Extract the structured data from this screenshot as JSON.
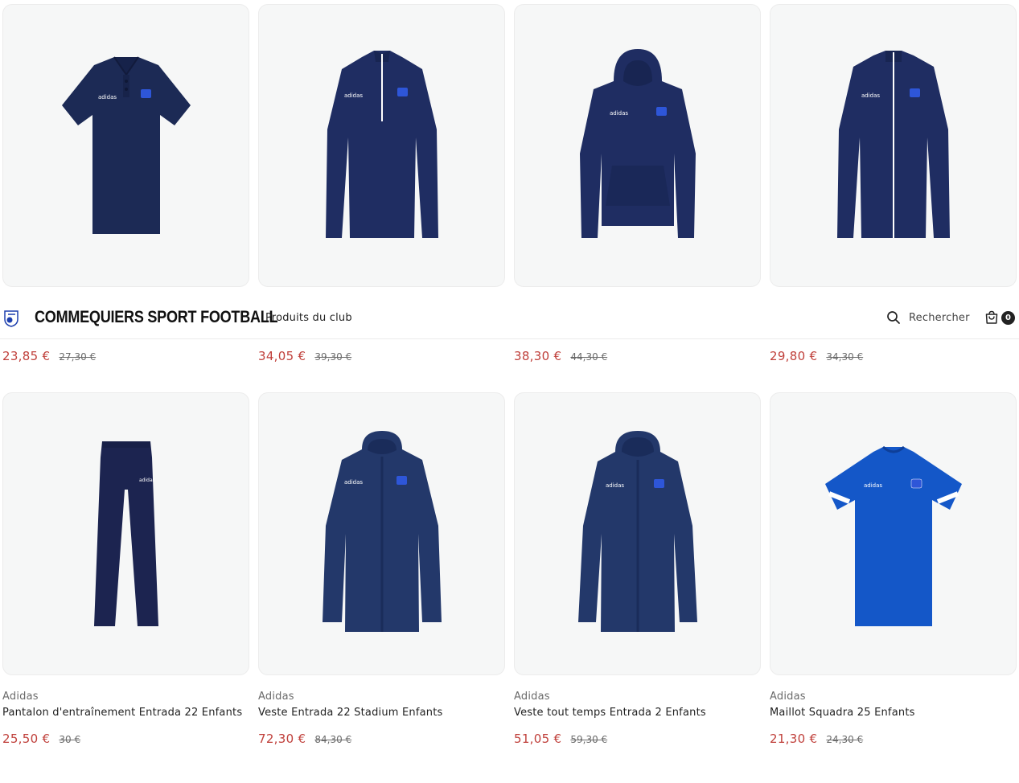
{
  "header": {
    "site_title": "COMMEQUIERS SPORT FOOTBALL",
    "nav": [
      {
        "label": "Produits du club"
      }
    ],
    "search_label": "Rechercher",
    "cart_count": "0"
  },
  "products": [
    {
      "brand": "",
      "name": "",
      "price": "23,85 €",
      "old_price": "27,30 €",
      "image": "polo-navy",
      "color": "#1c2a55"
    },
    {
      "brand": "",
      "name": "",
      "price": "34,05 €",
      "old_price": "39,30 €",
      "image": "quarter-zip-top-navy",
      "color": "#1f2d62"
    },
    {
      "brand": "",
      "name": "",
      "price": "38,30 €",
      "old_price": "44,30 €",
      "image": "hoodie-navy",
      "color": "#1f2d62"
    },
    {
      "brand": "",
      "name": "",
      "price": "29,80 €",
      "old_price": "34,30 €",
      "image": "track-jacket-navy",
      "color": "#1f2d62"
    },
    {
      "brand": "Adidas",
      "name": "Pantalon d'entraînement Entrada 22 Enfants",
      "price": "25,50 €",
      "old_price": "30 €",
      "image": "training-pants-navy",
      "color": "#1c2450"
    },
    {
      "brand": "Adidas",
      "name": "Veste Entrada 22 Stadium Enfants",
      "price": "72,30 €",
      "old_price": "84,30 €",
      "image": "stadium-jacket-navy",
      "color": "#23386a"
    },
    {
      "brand": "Adidas",
      "name": "Veste tout temps Entrada 2 Enfants",
      "price": "51,05 €",
      "old_price": "59,30 €",
      "image": "rain-jacket-navy",
      "color": "#23386a"
    },
    {
      "brand": "Adidas",
      "name": "Maillot Squadra 25 Enfants",
      "price": "21,30 €",
      "old_price": "24,30 €",
      "image": "jersey-royal-blue",
      "color": "#1457c8"
    }
  ]
}
